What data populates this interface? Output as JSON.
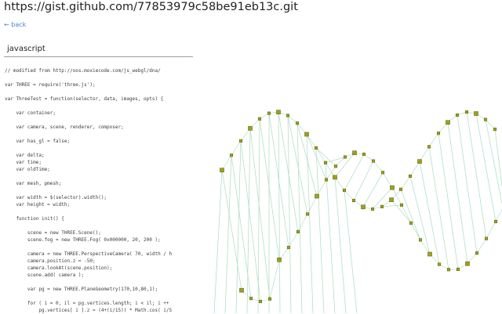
{
  "header": {
    "title": "https://gist.github.com/77853979c58be91eb13c.git",
    "back_label": "← back"
  },
  "language_select": {
    "value": "javascript"
  },
  "code": {
    "lines": [
      "// modified from http://oos.moxiecode.com/js_webgl/dna/",
      "",
      "var THREE = require('three.js');",
      "",
      "var ThreeTest = function(selector, data, images, opts) {",
      "",
      "    var container;",
      "",
      "    var camera, scene, renderer, composer;",
      "",
      "    var has_gl = false;",
      "",
      "    var delta;",
      "    var time;",
      "    var oldTime;",
      "",
      "    var mesh, pmesh;",
      "",
      "    var width = $(selector).width();",
      "    var height = width;",
      "",
      "    function init() {",
      "",
      "        scene = new THREE.Scene();",
      "        scene.fog = new THREE.Fog( 0x000000, 20, 200 );",
      "",
      "        camera = new THREE.PerspectiveCamera( 70, width / h",
      "        camera.position.z = -50;",
      "        camera.lookAt(scene.position);",
      "        scene.add( camera );",
      "",
      "        var pg = new THREE.PlaneGeometry(170,10,80,1);",
      "",
      "        for ( i = 0, il = pg.vertices.length; i < il; i ++",
      "            pg.vertices[ i ].z = (4+(i/15)) * Math.cos( i/5"
    ]
  },
  "visualization": {
    "line_color": "#a9dcc0",
    "node_color": "#9ea21c",
    "node_border": "#66680f"
  }
}
